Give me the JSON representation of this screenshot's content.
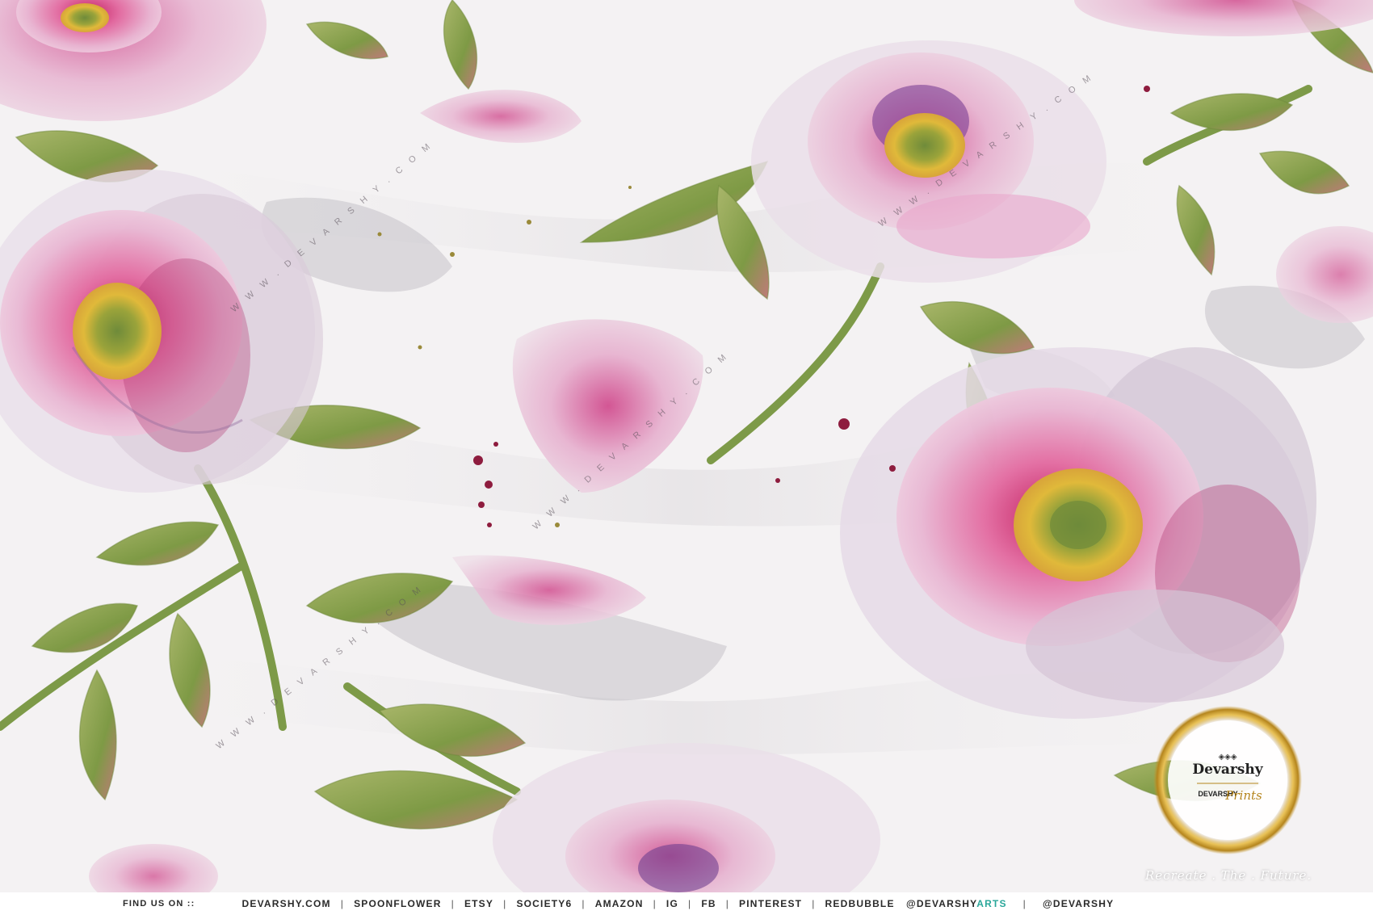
{
  "watermark": {
    "text": "W W W . D E V A R S H Y . C O M"
  },
  "footer": {
    "find_label": "FIND US ON ::",
    "links": [
      "DEVARSHY.COM",
      "SPOONFLOWER",
      "ETSY",
      "SOCIETY6",
      "AMAZON",
      "IG",
      "FB",
      "PINTEREST",
      "REDBUBBLE"
    ],
    "handle_1_main": "@DEVARSHY",
    "handle_1_accent": "ARTS",
    "handle_2": "@DEVARSHY"
  },
  "logo": {
    "brand": "Devarshy",
    "sub_brand": "DEVARSHY",
    "script": "Prints",
    "tagline": "Recreate . The . Future."
  },
  "colors": {
    "petal_pink": "#e2a7c9",
    "petal_magenta": "#d02a6f",
    "leaf_green": "#7e9a45",
    "stamen_yellow": "#d8b33c",
    "gold_ring": "#c79a2c",
    "accent_teal": "#2aa79a",
    "fabric_white": "#f4f2f3"
  }
}
